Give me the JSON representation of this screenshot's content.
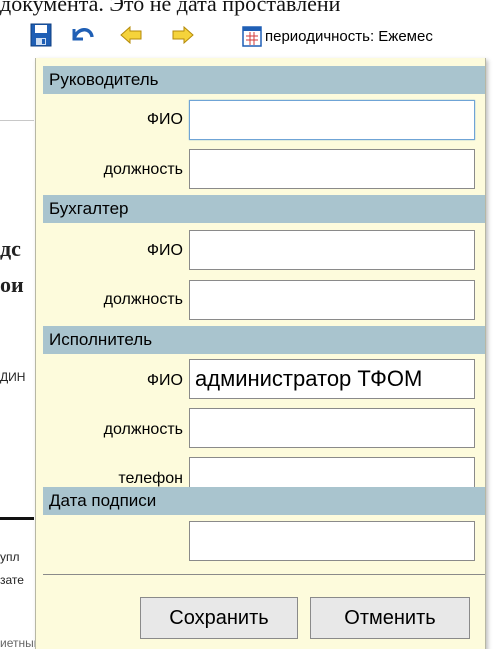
{
  "document": {
    "top_text": "документа. Это не дата проставлени"
  },
  "toolbar": {
    "save_icon": "save-icon",
    "undo_icon": "undo-icon",
    "back_icon": "arrow-left-icon",
    "forward_icon": "arrow-right-icon",
    "periodicity_icon": "calendar-icon",
    "periodicity_label": "периодичность: Ежемес"
  },
  "background": {
    "frag1": "дс",
    "frag2": "ои",
    "frag3": "ДИН",
    "frag4": "упл",
    "frag5": "зате",
    "frag6": "иетный перио"
  },
  "popup": {
    "head": {
      "header": "Руководитель",
      "fio_label": "ФИО",
      "fio_value": "",
      "position_label": "должность",
      "position_value": ""
    },
    "accountant": {
      "header": "Бухгалтер",
      "fio_label": "ФИО",
      "fio_value": "",
      "position_label": "должность",
      "position_value": ""
    },
    "executor": {
      "header": "Исполнитель",
      "fio_label": "ФИО",
      "fio_value": "администратор ТФОМ",
      "position_label": "должность",
      "position_value": "",
      "phone_label": "телефон",
      "phone_value": ""
    },
    "sign_date": {
      "header": "Дата подписи",
      "value": ""
    },
    "buttons": {
      "save": "Сохранить",
      "cancel": "Отменить"
    }
  },
  "colors": {
    "panel_bg": "#fdfbdc",
    "section_header_bg": "#a9c4ce",
    "focus_border": "#6fa4d6"
  }
}
